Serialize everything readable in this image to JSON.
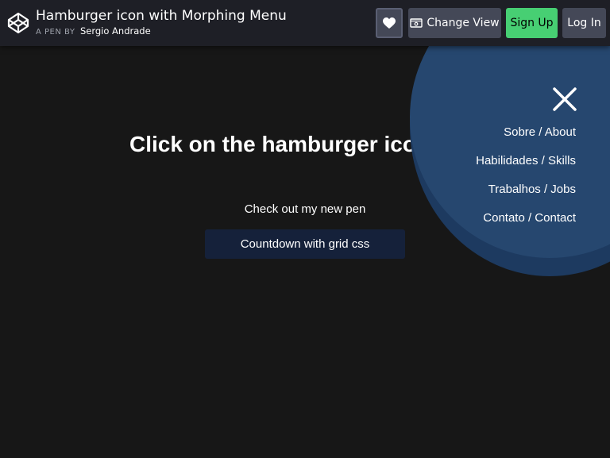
{
  "header": {
    "title": "Hamburger icon with Morphing Menu",
    "byline_prefix": "A PEN BY",
    "author": "Sergio Andrade",
    "buttons": {
      "change_view": "Change View",
      "sign_up": "Sign Up",
      "log_in": "Log In"
    },
    "icons": {
      "logo": "codepen-logo-icon",
      "heart": "heart-icon",
      "view": "eye-icon"
    }
  },
  "main": {
    "headline": "Click on the hamburger icon",
    "headline_arrow": "→",
    "checkout_text": "Check out my new pen",
    "pen_link": "Countdown with grid css"
  },
  "menu": {
    "close_icon": "close-icon",
    "items": [
      "Sobre / About",
      "Habilidades / Skills",
      "Trabalhos / Jobs",
      "Contato / Contact"
    ]
  },
  "colors": {
    "background": "#171717",
    "topbar": "#1e1f26",
    "menu_circle": "#26476f",
    "signup_green": "#47cf73",
    "button_gray": "#444857"
  }
}
